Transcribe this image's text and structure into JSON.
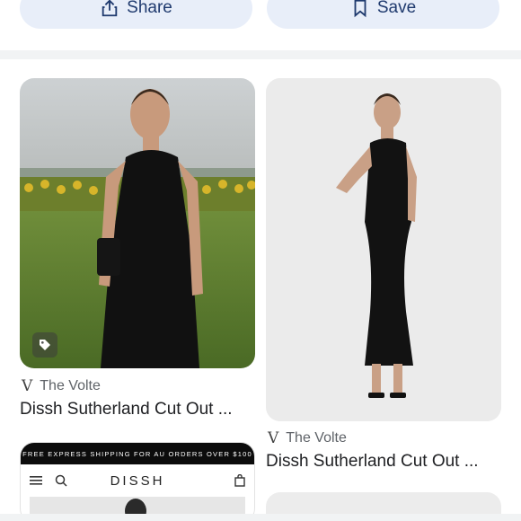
{
  "actions": {
    "share_label": "Share",
    "save_label": "Save"
  },
  "results": [
    {
      "source": "The Volte",
      "source_icon": "V",
      "title": "Dissh Sutherland Cut Out ..."
    },
    {
      "source": "The Volte",
      "source_icon": "V",
      "title": "Dissh Sutherland Cut Out ..."
    }
  ],
  "preview_site": {
    "shipping_banner": "FREE EXPRESS SHIPPING FOR AU ORDERS OVER $100",
    "brand": "DISSH"
  },
  "colors": {
    "pill_bg": "#e8eef9",
    "pill_text": "#1f3a6e"
  }
}
